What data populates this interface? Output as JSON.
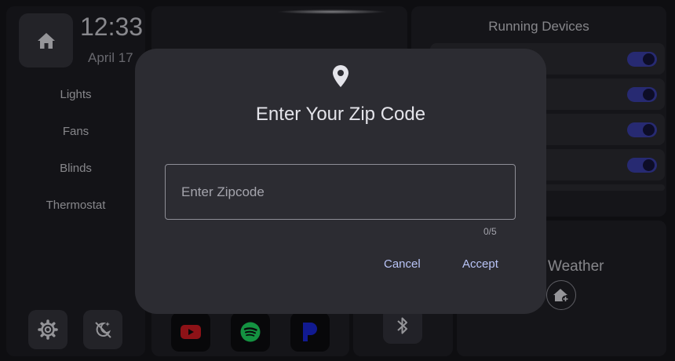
{
  "sidebar": {
    "time": "12:33",
    "date": "April 17",
    "nav": [
      "Lights",
      "Fans",
      "Blinds",
      "Thermostat"
    ]
  },
  "running": {
    "title": "Running Devices",
    "device_count_visible": 4
  },
  "weather": {
    "title": "Weather"
  },
  "media": {
    "apps": [
      "youtube-icon",
      "spotify-icon",
      "pandora-icon"
    ]
  },
  "dialog": {
    "title": "Enter Your Zip Code",
    "input_placeholder": "Enter Zipcode",
    "input_value": "",
    "char_count": "0/5",
    "cancel_label": "Cancel",
    "accept_label": "Accept"
  },
  "colors": {
    "accent": "#3a3fa8",
    "dialog_bg": "#2c2c32",
    "button_text": "#b9c4f7"
  }
}
